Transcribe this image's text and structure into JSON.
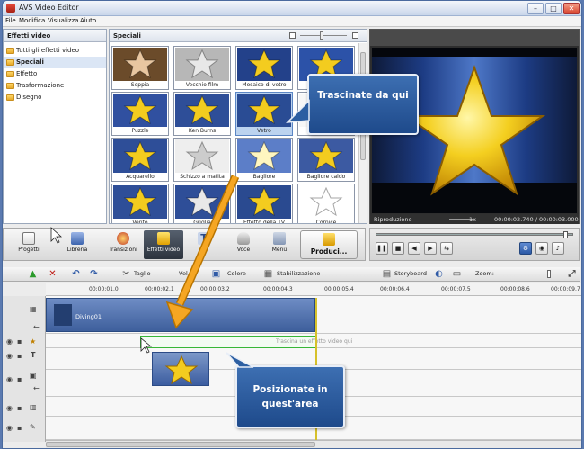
{
  "window": {
    "title": "AVS Video Editor",
    "btn_min": "–",
    "btn_max": "□",
    "btn_close": "✕"
  },
  "menu": [
    "File",
    "Modifica",
    "Visualizza",
    "Aiuto"
  ],
  "effects_panel": {
    "title": "Effetti video",
    "items": [
      "Tutti gli effetti video",
      "Speciali",
      "Effetto",
      "Trasformazione",
      "Disegno"
    ],
    "selected_index": 1
  },
  "special_panel": {
    "title": "Speciali",
    "thumbs": [
      {
        "label": "Seppia"
      },
      {
        "label": "Vecchio film"
      },
      {
        "label": "Mosaico di vetro"
      },
      {
        "label": "Mos"
      },
      {
        "label": "Puzzle"
      },
      {
        "label": "Ken Burns"
      },
      {
        "label": "Vetro"
      },
      {
        "label": ""
      },
      {
        "label": "Acquarello"
      },
      {
        "label": "Schizzo a matita"
      },
      {
        "label": "Bagliore"
      },
      {
        "label": "Bagliore caldo"
      },
      {
        "label": "Vento"
      },
      {
        "label": "Griglia"
      },
      {
        "label": "Effetto della TV"
      },
      {
        "label": "Cornice"
      }
    ],
    "selected_index": 6
  },
  "preview": {
    "status": "Riproduzione",
    "speed": "1x",
    "time": "00:00:02.740 / 00:00:03.000"
  },
  "toolbar": {
    "progetti": "Progetti",
    "libreria": "Libreria",
    "transizioni": "Transizioni",
    "effetti_video": "Effetti video",
    "voce": "Voce",
    "menu": "Menù",
    "produci": "Produci..."
  },
  "timeline_toolbar": {
    "taglio": "Taglio",
    "velocita": "Vel",
    "colore": "Colore",
    "stabilizzazione": "Stabilizzazione",
    "storyboard": "Storyboard",
    "zoom": "Zoom:"
  },
  "ruler": [
    "00:00:01.0",
    "00:00:02.1",
    "00:00:03.2",
    "00:00:04.3",
    "00:00:05.4",
    "00:00:06.4",
    "00:00:07.5",
    "00:00:08.6",
    "00:00:09.7"
  ],
  "timeline": {
    "clip_label": "Diving01",
    "drop_hint": "Trascina un effetto video qui"
  },
  "callouts": {
    "drag": "Trascinate da qui",
    "drop": "Posizionate in quest'area"
  },
  "colors": {
    "accent": "#3d6fb2",
    "arrow": "#f5a623",
    "drop_zone": "#37b737"
  }
}
